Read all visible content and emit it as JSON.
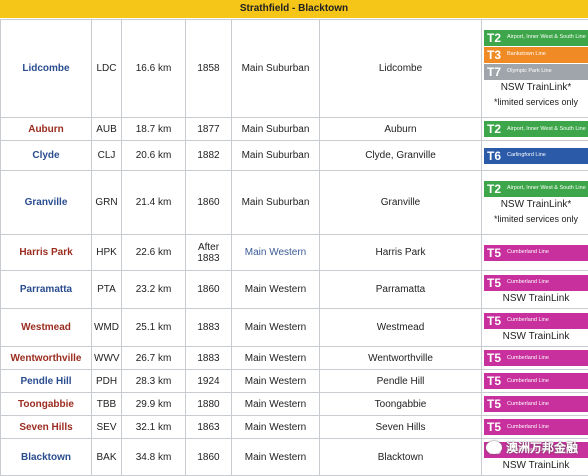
{
  "header": {
    "title": "Strathfield - Blacktown"
  },
  "colors": {
    "name_colors": {
      "blue": "#2a4d8f",
      "red": "#9b2c1f"
    },
    "main_western_color": "#3b5b95",
    "lines": {
      "T2": "#3ea64a",
      "T3": "#f08a24",
      "T7": "#a0a5ab",
      "T6": "#2a5aa8",
      "T5": "#c7309d"
    }
  },
  "line_descriptions": {
    "T2": "Airport, Inner West & South Line",
    "T3": "Bankstown Line",
    "T7": "Olympic Park Line",
    "T6": "Carlingford Line",
    "T5": "Cumberland Line"
  },
  "stations": [
    {
      "name": "Lidcombe",
      "color": "blue",
      "code": "LDC",
      "distance": "16.6 km",
      "opened": "1858",
      "line": "Main Suburban",
      "suburb": "Lidcombe",
      "badges": [
        "T2",
        "T3",
        "T7"
      ],
      "trainlink": "NSW TrainLink*",
      "note": "*limited services only"
    },
    {
      "name": "Auburn",
      "color": "red",
      "code": "AUB",
      "distance": "18.7 km",
      "opened": "1877",
      "line": "Main Suburban",
      "suburb": "Auburn",
      "badges": [
        "T2"
      ],
      "trainlink": "",
      "note": ""
    },
    {
      "name": "Clyde",
      "color": "blue",
      "code": "CLJ",
      "distance": "20.6 km",
      "opened": "1882",
      "line": "Main Suburban",
      "suburb": "Clyde, Granville",
      "badges": [
        "T6"
      ],
      "trainlink": "",
      "note": ""
    },
    {
      "name": "Granville",
      "color": "blue",
      "code": "GRN",
      "distance": "21.4 km",
      "opened": "1860",
      "line": "Main Suburban",
      "suburb": "Granville",
      "badges": [
        "T2"
      ],
      "trainlink": "NSW TrainLink*",
      "note": "*limited services only"
    },
    {
      "name": "Harris Park",
      "color": "red",
      "code": "HPK",
      "distance": "22.6 km",
      "opened": "After 1883",
      "line": "Main Western",
      "line_link": true,
      "suburb": "Harris Park",
      "badges": [
        "T5"
      ],
      "trainlink": "",
      "note": ""
    },
    {
      "name": "Parramatta",
      "color": "blue",
      "code": "PTA",
      "distance": "23.2 km",
      "opened": "1860",
      "line": "Main Western",
      "suburb": "Parramatta",
      "badges": [
        "T5"
      ],
      "trainlink": "NSW TrainLink",
      "note": ""
    },
    {
      "name": "Westmead",
      "color": "red",
      "code": "WMD",
      "distance": "25.1 km",
      "opened": "1883",
      "line": "Main Western",
      "suburb": "Westmead",
      "badges": [
        "T5"
      ],
      "trainlink": "NSW TrainLink",
      "note": ""
    },
    {
      "name": "Wentworthville",
      "color": "red",
      "code": "WWV",
      "distance": "26.7 km",
      "opened": "1883",
      "line": "Main Western",
      "suburb": "Wentworthville",
      "badges": [
        "T5"
      ],
      "trainlink": "",
      "note": ""
    },
    {
      "name": "Pendle Hill",
      "color": "blue",
      "code": "PDH",
      "distance": "28.3 km",
      "opened": "1924",
      "line": "Main Western",
      "suburb": "Pendle Hill",
      "badges": [
        "T5"
      ],
      "trainlink": "",
      "note": ""
    },
    {
      "name": "Toongabbie",
      "color": "red",
      "code": "TBB",
      "distance": "29.9 km",
      "opened": "1880",
      "line": "Main Western",
      "suburb": "Toongabbie",
      "badges": [
        "T5"
      ],
      "trainlink": "",
      "note": ""
    },
    {
      "name": "Seven Hills",
      "color": "red",
      "code": "SEV",
      "distance": "32.1 km",
      "opened": "1863",
      "line": "Main Western",
      "suburb": "Seven Hills",
      "badges": [
        "T5"
      ],
      "trainlink": "",
      "note": ""
    },
    {
      "name": "Blacktown",
      "color": "blue",
      "code": "BAK",
      "distance": "34.8 km",
      "opened": "1860",
      "line": "Main Western",
      "suburb": "Blacktown",
      "badges": [
        "T5"
      ],
      "trainlink": "NSW TrainLink",
      "note": ""
    }
  ],
  "watermark": {
    "text": "澳洲万邦金融",
    "icon": "wechat-bubble-icon"
  }
}
